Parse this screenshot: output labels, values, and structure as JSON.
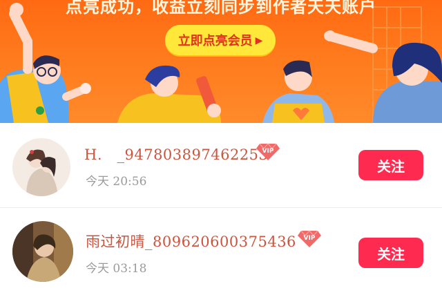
{
  "banner": {
    "headline": "点亮成功，收益立刻同步到作者天天账户",
    "cta_label": "立即点亮会员",
    "colors": {
      "background": "#ff6a12",
      "cta": "#ffe83a",
      "cta_text": "#e3311d"
    }
  },
  "list": {
    "items": [
      {
        "username": "H.　_947803897462253",
        "time": "今天 20:56",
        "badge": "VIP",
        "follow_label": "关注"
      },
      {
        "username": "雨过初晴_809620600375436",
        "time": "今天 03:18",
        "badge": "VIP",
        "follow_label": "关注"
      }
    ],
    "colors": {
      "username": "#c9553f",
      "time": "#9a9a9a",
      "follow_button": "#ff2a4f"
    }
  },
  "icons": [
    "vip-diamond-icon",
    "play-arrow-icon"
  ]
}
